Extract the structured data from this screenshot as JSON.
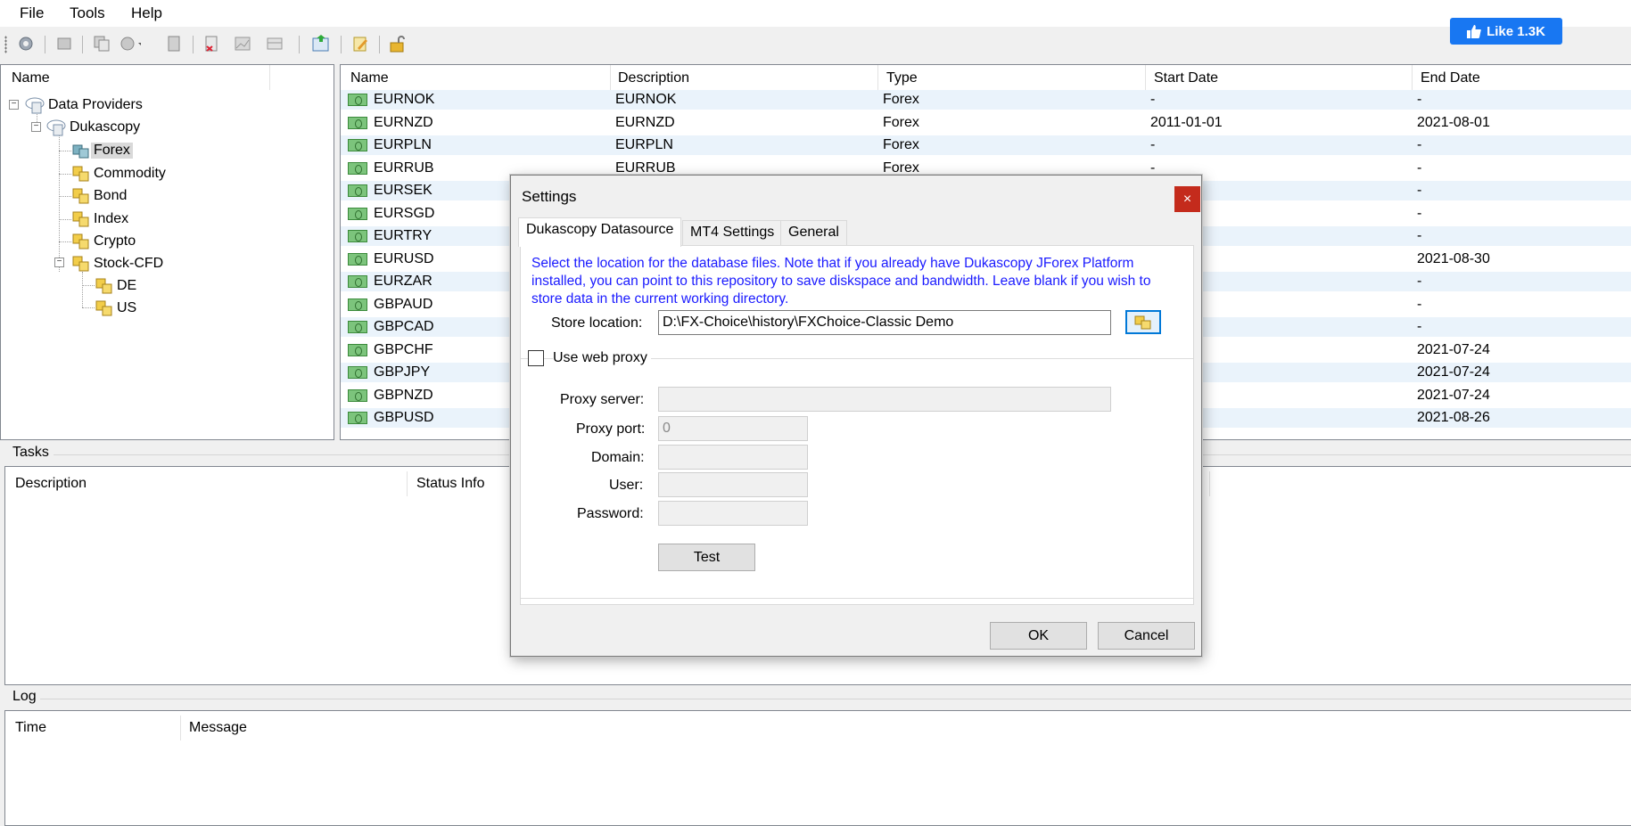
{
  "menu": {
    "file": "File",
    "tools": "Tools",
    "help": "Help"
  },
  "like_button": {
    "label": "Like 1.3K"
  },
  "tree": {
    "header": "Name",
    "nodes": {
      "root": "Data Providers",
      "provider": "Dukascopy",
      "forex": "Forex",
      "commodity": "Commodity",
      "bond": "Bond",
      "index": "Index",
      "crypto": "Crypto",
      "stock": "Stock-CFD",
      "de": "DE",
      "us": "US"
    }
  },
  "grid": {
    "headers": {
      "name": "Name",
      "description": "Description",
      "type": "Type",
      "start": "Start Date",
      "end": "End Date"
    },
    "rows": [
      {
        "name": "EURNOK",
        "description": "EURNOK",
        "type": "Forex",
        "start": "-",
        "end": "-"
      },
      {
        "name": "EURNZD",
        "description": "EURNZD",
        "type": "Forex",
        "start": "2011-01-01",
        "end": "2021-08-01"
      },
      {
        "name": "EURPLN",
        "description": "EURPLN",
        "type": "Forex",
        "start": "-",
        "end": "-"
      },
      {
        "name": "EURRUB",
        "description": "EURRUB",
        "type": "Forex",
        "start": "-",
        "end": "-"
      },
      {
        "name": "EURSEK",
        "description": "",
        "type": "",
        "start": "",
        "end": "-"
      },
      {
        "name": "EURSGD",
        "description": "",
        "type": "",
        "start": "",
        "end": "-"
      },
      {
        "name": "EURTRY",
        "description": "",
        "type": "",
        "start": "",
        "end": "-"
      },
      {
        "name": "EURUSD",
        "description": "",
        "type": "",
        "start": "-01",
        "end": "2021-08-30"
      },
      {
        "name": "EURZAR",
        "description": "",
        "type": "",
        "start": "",
        "end": "-"
      },
      {
        "name": "GBPAUD",
        "description": "",
        "type": "",
        "start": "",
        "end": "-"
      },
      {
        "name": "GBPCAD",
        "description": "",
        "type": "",
        "start": "",
        "end": "-"
      },
      {
        "name": "GBPCHF",
        "description": "",
        "type": "",
        "start": "2-01",
        "end": "2021-07-24"
      },
      {
        "name": "GBPJPY",
        "description": "",
        "type": "",
        "start": "-01",
        "end": "2021-07-24"
      },
      {
        "name": "GBPNZD",
        "description": "",
        "type": "",
        "start": "-01",
        "end": "2021-07-24"
      },
      {
        "name": "GBPUSD",
        "description": "",
        "type": "",
        "start": "-01",
        "end": "2021-08-26"
      }
    ]
  },
  "tasks": {
    "title": "Tasks",
    "col_description": "Description",
    "col_status": "Status Info"
  },
  "log": {
    "title": "Log",
    "col_time": "Time",
    "col_message": "Message"
  },
  "dialog": {
    "title": "Settings",
    "close": "×",
    "tabs": [
      "Dukascopy Datasource",
      "MT4 Settings",
      "General"
    ],
    "info": "Select the location for the database files.  Note that if you already have Dukascopy JForex Platform installed, you can point to this repository to save diskspace and bandwidth.  Leave blank if you wish to store data in the current working directory.",
    "store_location_label": "Store location:",
    "store_location_value": "D:\\FX-Choice\\history\\FXChoice-Classic Demo",
    "use_proxy_label": "Use web proxy",
    "use_proxy_checked": false,
    "proxy_server_label": "Proxy server:",
    "proxy_server_value": "",
    "proxy_port_label": "Proxy port:",
    "proxy_port_value": "0",
    "domain_label": "Domain:",
    "domain_value": "",
    "user_label": "User:",
    "user_value": "",
    "password_label": "Password:",
    "password_value": "",
    "test_button": "Test",
    "ok_button": "OK",
    "cancel_button": "Cancel"
  },
  "colors": {
    "accent": "#0078d7",
    "info_text": "#1a1aff",
    "close_red": "#c42b1c",
    "alt_row": "#eaf3fb",
    "like_blue": "#1877f2"
  }
}
